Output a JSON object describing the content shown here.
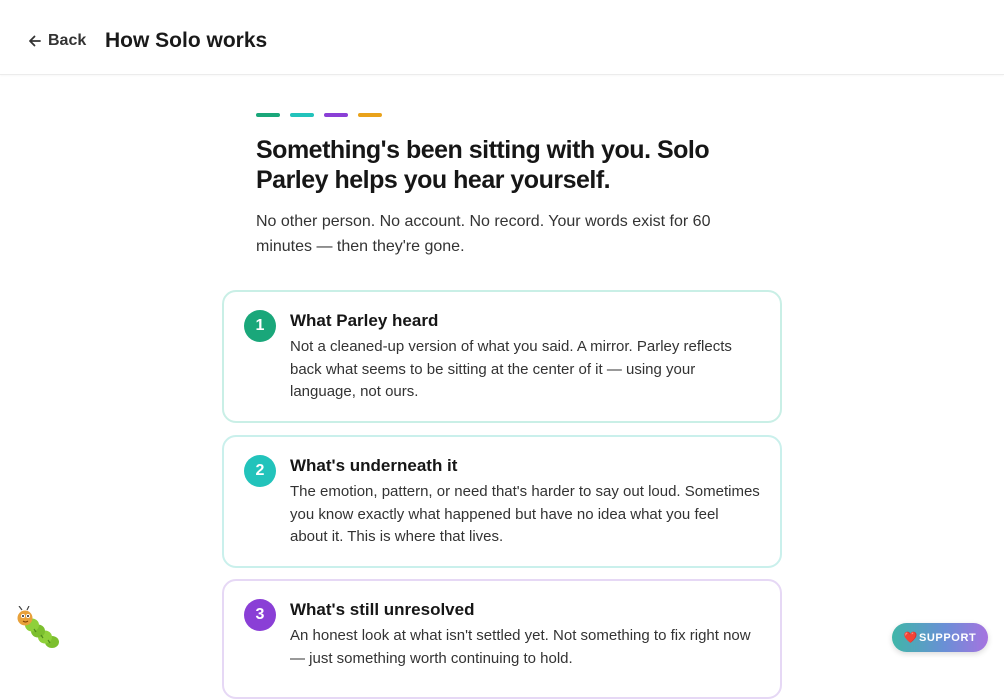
{
  "header": {
    "back_label": "Back",
    "title": "How Solo works"
  },
  "accents": [
    "#1aa77a",
    "#22c3bb",
    "#8a3fd6",
    "#e9a21a"
  ],
  "hero": {
    "heading": "Something's been sitting with you. Solo Parley helps you hear yourself.",
    "subtext": "No other person. No account. No record. Your words exist for 60 minutes — then they're gone."
  },
  "steps": [
    {
      "number": "1",
      "title": "What Parley heard",
      "body": "Not a cleaned-up version of what you said. A mirror. Parley reflects back what seems to be sitting at the center of it — using your language, not ours.",
      "color": "#1aa77a",
      "border": "#c9efe6"
    },
    {
      "number": "2",
      "title": "What's underneath it",
      "body": "The emotion, pattern, or need that's harder to say out loud. Sometimes you know exactly what happened but have no idea what you feel about it. This is where that lives.",
      "color": "#22c3bb",
      "border": "#caf0ec"
    },
    {
      "number": "3",
      "title": "What's still unresolved",
      "body": "An honest look at what isn't settled yet. Not something to fix right now — just something worth continuing to hold.",
      "color": "#8a3fd6",
      "border": "#e6d8f5"
    }
  ],
  "support": {
    "icon": "heart-icon",
    "label": "SUPPORT"
  },
  "mascot": {
    "icon": "caterpillar-icon"
  }
}
